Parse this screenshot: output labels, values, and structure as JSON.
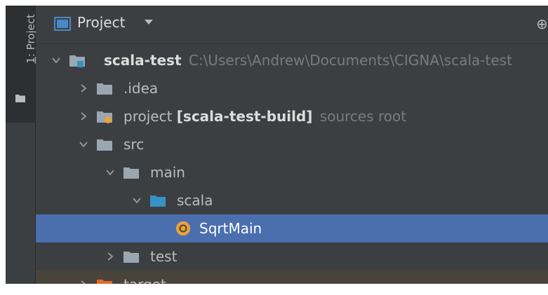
{
  "sidebar": {
    "tab_number": "1",
    "tab_label": ": Project"
  },
  "header": {
    "title": "Project",
    "icon": "project-view-icon",
    "caret_icon": "caret-down-icon",
    "right_icon": "target-icon",
    "right_glyph": "⊕"
  },
  "tree": [
    {
      "name": "scala-test",
      "path": "C:\\Users\\Andrew\\Documents\\CIGNA\\scala-test",
      "expanded": true,
      "icon": "module-folder-icon"
    },
    {
      "name": ".idea",
      "expanded": false,
      "icon": "folder-icon"
    },
    {
      "name": "project",
      "extra": "[scala-test-build]",
      "hint": "sources root",
      "expanded": false,
      "icon": "sources-root-folder-icon"
    },
    {
      "name": "src",
      "expanded": true,
      "icon": "folder-icon"
    },
    {
      "name": "main",
      "expanded": true,
      "icon": "folder-icon"
    },
    {
      "name": "scala",
      "expanded": true,
      "icon": "source-folder-icon"
    },
    {
      "name": "SqrtMain",
      "selected": true,
      "icon": "scala-object-icon"
    },
    {
      "name": "test",
      "expanded": false,
      "icon": "folder-icon"
    },
    {
      "name": "target",
      "expanded": false,
      "icon": "excluded-folder-icon"
    }
  ],
  "colors": {
    "background": "#3c3f41",
    "selection": "#4b6eaf",
    "excluded_row": "#49443a",
    "excluded_folder": "#e06b2c",
    "source_folder": "#3592c4",
    "scala_object": "#e8a33d"
  }
}
